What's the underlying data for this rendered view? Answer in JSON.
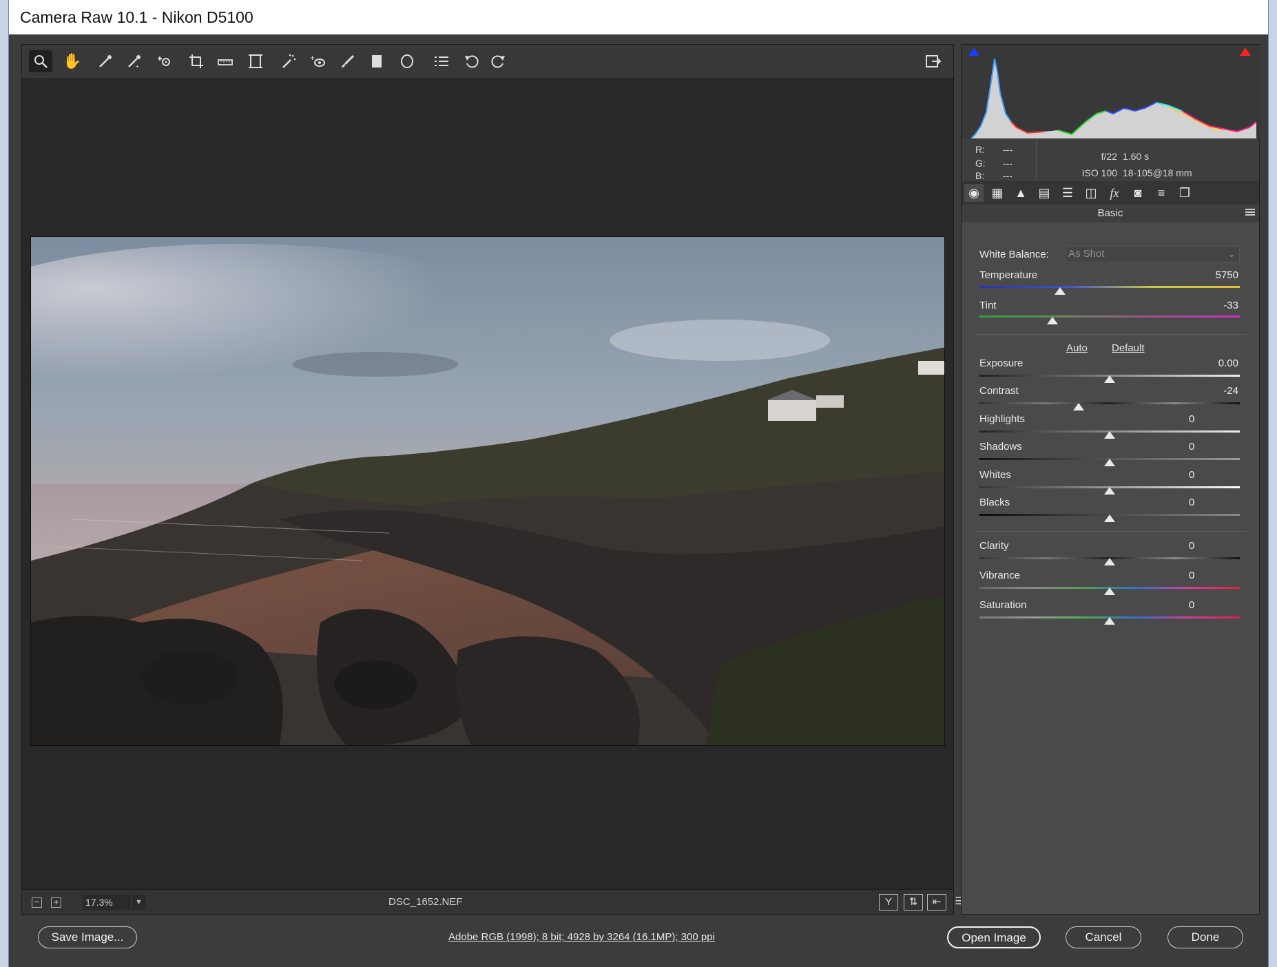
{
  "window": {
    "title": "Camera Raw 10.1  -  Nikon D5100"
  },
  "toolbar": {
    "tools": [
      "zoom-tool-icon",
      "hand-tool-icon",
      "white-balance-tool-icon",
      "color-sampler-tool-icon",
      "targeted-adjustment-tool-icon",
      "crop-tool-icon",
      "straighten-tool-icon",
      "transform-tool-icon",
      "spot-removal-tool-icon",
      "red-eye-removal-tool-icon",
      "adjustment-brush-icon",
      "graduated-filter-icon",
      "radial-filter-icon",
      "preferences-list-icon",
      "rotate-left-icon",
      "rotate-right-icon"
    ],
    "fullscreen_icon": "toggle-fullscreen-icon"
  },
  "photo": {
    "filename": "DSC_1652.NEF"
  },
  "statusbar": {
    "zoom_out": "−",
    "zoom_in": "+",
    "zoom": "17.3%",
    "view_icons": [
      "before-after-y-icon",
      "swap-settings-icon",
      "copy-settings-icon",
      "toggle-settings-icon"
    ]
  },
  "histogram": {
    "shadow_clip_color": "#1a3cff",
    "highlight_clip_color": "#ff2020"
  },
  "info": {
    "r_label": "R:",
    "r_value": "---",
    "g_label": "G:",
    "g_value": "---",
    "b_label": "B:",
    "b_value": "---",
    "aperture": "f/22",
    "shutter": "1.60 s",
    "iso": "ISO 100",
    "lens": "18-105@18 mm"
  },
  "panel_tabs": [
    "basic-tab-icon",
    "tone-curve-tab-icon",
    "detail-tab-icon",
    "hsl-tab-icon",
    "split-toning-tab-icon",
    "lens-corrections-tab-icon",
    "effects-tab-icon",
    "camera-calibration-tab-icon",
    "presets-tab-icon",
    "snapshots-tab-icon"
  ],
  "panel": {
    "title": "Basic",
    "white_balance_label": "White Balance:",
    "white_balance_value": "As Shot",
    "auto": "Auto",
    "default": "Default",
    "sliders": [
      {
        "label": "Temperature",
        "value": "5750",
        "position": 0.31
      },
      {
        "label": "Tint",
        "value": "-33",
        "position": 0.28
      },
      {
        "label": "Exposure",
        "value": "0.00",
        "position": 0.5
      },
      {
        "label": "Contrast",
        "value": "-24",
        "position": 0.38
      },
      {
        "label": "Highlights",
        "value": "0",
        "position": 0.5
      },
      {
        "label": "Shadows",
        "value": "0",
        "position": 0.5
      },
      {
        "label": "Whites",
        "value": "0",
        "position": 0.5
      },
      {
        "label": "Blacks",
        "value": "0",
        "position": 0.5
      },
      {
        "label": "Clarity",
        "value": "0",
        "position": 0.5
      },
      {
        "label": "Vibrance",
        "value": "0",
        "position": 0.5
      },
      {
        "label": "Saturation",
        "value": "0",
        "position": 0.5
      }
    ]
  },
  "footer": {
    "save": "Save Image...",
    "workflow": "Adobe RGB (1998); 8 bit; 4928 by 3264 (16.1MP); 300 ppi",
    "open": "Open Image",
    "cancel": "Cancel",
    "done": "Done"
  }
}
